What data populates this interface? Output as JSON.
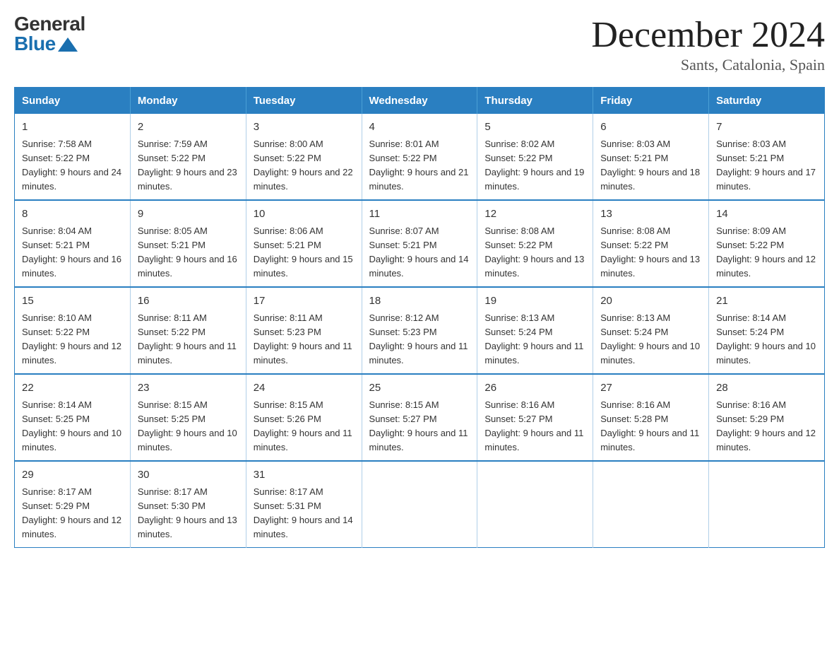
{
  "logo": {
    "general": "General",
    "blue": "Blue"
  },
  "title": "December 2024",
  "subtitle": "Sants, Catalonia, Spain",
  "header_days": [
    "Sunday",
    "Monday",
    "Tuesday",
    "Wednesday",
    "Thursday",
    "Friday",
    "Saturday"
  ],
  "weeks": [
    [
      {
        "day": "1",
        "sunrise": "Sunrise: 7:58 AM",
        "sunset": "Sunset: 5:22 PM",
        "daylight": "Daylight: 9 hours and 24 minutes."
      },
      {
        "day": "2",
        "sunrise": "Sunrise: 7:59 AM",
        "sunset": "Sunset: 5:22 PM",
        "daylight": "Daylight: 9 hours and 23 minutes."
      },
      {
        "day": "3",
        "sunrise": "Sunrise: 8:00 AM",
        "sunset": "Sunset: 5:22 PM",
        "daylight": "Daylight: 9 hours and 22 minutes."
      },
      {
        "day": "4",
        "sunrise": "Sunrise: 8:01 AM",
        "sunset": "Sunset: 5:22 PM",
        "daylight": "Daylight: 9 hours and 21 minutes."
      },
      {
        "day": "5",
        "sunrise": "Sunrise: 8:02 AM",
        "sunset": "Sunset: 5:22 PM",
        "daylight": "Daylight: 9 hours and 19 minutes."
      },
      {
        "day": "6",
        "sunrise": "Sunrise: 8:03 AM",
        "sunset": "Sunset: 5:21 PM",
        "daylight": "Daylight: 9 hours and 18 minutes."
      },
      {
        "day": "7",
        "sunrise": "Sunrise: 8:03 AM",
        "sunset": "Sunset: 5:21 PM",
        "daylight": "Daylight: 9 hours and 17 minutes."
      }
    ],
    [
      {
        "day": "8",
        "sunrise": "Sunrise: 8:04 AM",
        "sunset": "Sunset: 5:21 PM",
        "daylight": "Daylight: 9 hours and 16 minutes."
      },
      {
        "day": "9",
        "sunrise": "Sunrise: 8:05 AM",
        "sunset": "Sunset: 5:21 PM",
        "daylight": "Daylight: 9 hours and 16 minutes."
      },
      {
        "day": "10",
        "sunrise": "Sunrise: 8:06 AM",
        "sunset": "Sunset: 5:21 PM",
        "daylight": "Daylight: 9 hours and 15 minutes."
      },
      {
        "day": "11",
        "sunrise": "Sunrise: 8:07 AM",
        "sunset": "Sunset: 5:21 PM",
        "daylight": "Daylight: 9 hours and 14 minutes."
      },
      {
        "day": "12",
        "sunrise": "Sunrise: 8:08 AM",
        "sunset": "Sunset: 5:22 PM",
        "daylight": "Daylight: 9 hours and 13 minutes."
      },
      {
        "day": "13",
        "sunrise": "Sunrise: 8:08 AM",
        "sunset": "Sunset: 5:22 PM",
        "daylight": "Daylight: 9 hours and 13 minutes."
      },
      {
        "day": "14",
        "sunrise": "Sunrise: 8:09 AM",
        "sunset": "Sunset: 5:22 PM",
        "daylight": "Daylight: 9 hours and 12 minutes."
      }
    ],
    [
      {
        "day": "15",
        "sunrise": "Sunrise: 8:10 AM",
        "sunset": "Sunset: 5:22 PM",
        "daylight": "Daylight: 9 hours and 12 minutes."
      },
      {
        "day": "16",
        "sunrise": "Sunrise: 8:11 AM",
        "sunset": "Sunset: 5:22 PM",
        "daylight": "Daylight: 9 hours and 11 minutes."
      },
      {
        "day": "17",
        "sunrise": "Sunrise: 8:11 AM",
        "sunset": "Sunset: 5:23 PM",
        "daylight": "Daylight: 9 hours and 11 minutes."
      },
      {
        "day": "18",
        "sunrise": "Sunrise: 8:12 AM",
        "sunset": "Sunset: 5:23 PM",
        "daylight": "Daylight: 9 hours and 11 minutes."
      },
      {
        "day": "19",
        "sunrise": "Sunrise: 8:13 AM",
        "sunset": "Sunset: 5:24 PM",
        "daylight": "Daylight: 9 hours and 11 minutes."
      },
      {
        "day": "20",
        "sunrise": "Sunrise: 8:13 AM",
        "sunset": "Sunset: 5:24 PM",
        "daylight": "Daylight: 9 hours and 10 minutes."
      },
      {
        "day": "21",
        "sunrise": "Sunrise: 8:14 AM",
        "sunset": "Sunset: 5:24 PM",
        "daylight": "Daylight: 9 hours and 10 minutes."
      }
    ],
    [
      {
        "day": "22",
        "sunrise": "Sunrise: 8:14 AM",
        "sunset": "Sunset: 5:25 PM",
        "daylight": "Daylight: 9 hours and 10 minutes."
      },
      {
        "day": "23",
        "sunrise": "Sunrise: 8:15 AM",
        "sunset": "Sunset: 5:25 PM",
        "daylight": "Daylight: 9 hours and 10 minutes."
      },
      {
        "day": "24",
        "sunrise": "Sunrise: 8:15 AM",
        "sunset": "Sunset: 5:26 PM",
        "daylight": "Daylight: 9 hours and 11 minutes."
      },
      {
        "day": "25",
        "sunrise": "Sunrise: 8:15 AM",
        "sunset": "Sunset: 5:27 PM",
        "daylight": "Daylight: 9 hours and 11 minutes."
      },
      {
        "day": "26",
        "sunrise": "Sunrise: 8:16 AM",
        "sunset": "Sunset: 5:27 PM",
        "daylight": "Daylight: 9 hours and 11 minutes."
      },
      {
        "day": "27",
        "sunrise": "Sunrise: 8:16 AM",
        "sunset": "Sunset: 5:28 PM",
        "daylight": "Daylight: 9 hours and 11 minutes."
      },
      {
        "day": "28",
        "sunrise": "Sunrise: 8:16 AM",
        "sunset": "Sunset: 5:29 PM",
        "daylight": "Daylight: 9 hours and 12 minutes."
      }
    ],
    [
      {
        "day": "29",
        "sunrise": "Sunrise: 8:17 AM",
        "sunset": "Sunset: 5:29 PM",
        "daylight": "Daylight: 9 hours and 12 minutes."
      },
      {
        "day": "30",
        "sunrise": "Sunrise: 8:17 AM",
        "sunset": "Sunset: 5:30 PM",
        "daylight": "Daylight: 9 hours and 13 minutes."
      },
      {
        "day": "31",
        "sunrise": "Sunrise: 8:17 AM",
        "sunset": "Sunset: 5:31 PM",
        "daylight": "Daylight: 9 hours and 14 minutes."
      },
      null,
      null,
      null,
      null
    ]
  ]
}
